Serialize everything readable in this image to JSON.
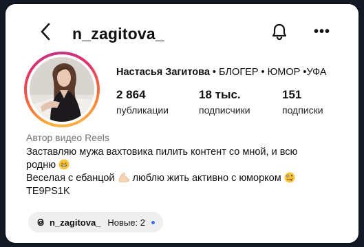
{
  "header": {
    "username": "n_zagitova_",
    "back_icon": "chevron-left-icon",
    "bell_icon": "bell-icon",
    "more_label": "•••"
  },
  "profile": {
    "display_name": "Настасья Загитова",
    "tags": " •  БЛОГЕР • ЮМОР •УФА",
    "stats": [
      {
        "value": "2 864",
        "label": "публикации"
      },
      {
        "value": "18 тыс.",
        "label": "подписчики"
      },
      {
        "value": "151",
        "label": "подписки"
      }
    ],
    "category": "Автор видео Reels",
    "bio": {
      "line1": "Заставляю мужа вахтовика пилить контент со мной, и всю",
      "line2": "родню",
      "line3a": "Веселая с ебанцой",
      "line3b": "люблю жить активно с юморком",
      "line4": "TE9PS1K"
    }
  },
  "threads": {
    "username": "n_zagitova_",
    "new_label": "Новые: 2",
    "icon": "threads-icon"
  },
  "colors": {
    "background": "#131a26",
    "card": "#ffffff",
    "pill": "#efefef",
    "new_dot": "#3c6ef0",
    "ring_start": "#fbb03b",
    "ring_end": "#c13584"
  }
}
